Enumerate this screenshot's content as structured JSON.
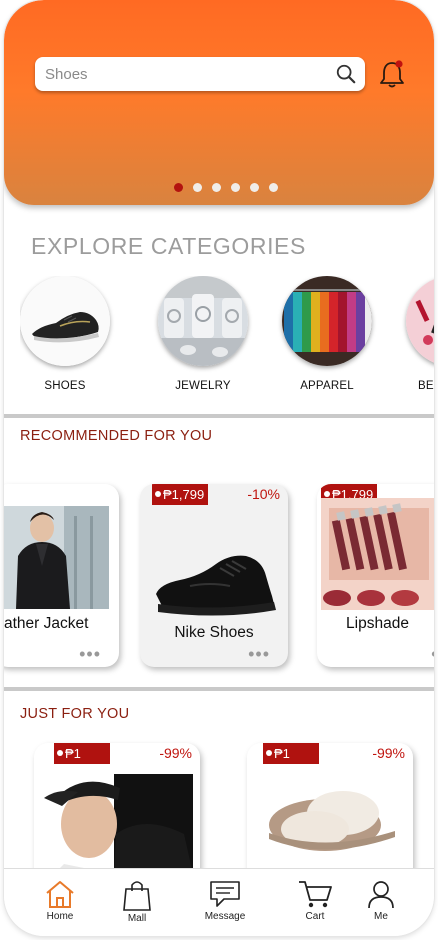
{
  "header": {
    "search_placeholder": "Shoes",
    "carousel_pages": 6,
    "carousel_active": 0
  },
  "colors": {
    "brand_orange": "#ff6a23",
    "accent_red": "#b0120f",
    "section_title": "#8b1f10"
  },
  "explore": {
    "title": "EXPLORE CATEGORIES",
    "items": [
      {
        "label": "SHOES",
        "icon": "sneaker-image"
      },
      {
        "label": "JEWELRY",
        "icon": "jewelry-image"
      },
      {
        "label": "APPAREL",
        "icon": "apparel-image"
      },
      {
        "label": "BEA",
        "icon": "beauty-image"
      }
    ]
  },
  "recommended": {
    "title": "RECOMMENDED FOR YOU",
    "items": [
      {
        "name": "ather Jacket",
        "price": "",
        "discount": ""
      },
      {
        "name": "Nike Shoes",
        "price": "₱1,799",
        "discount": "-10%"
      },
      {
        "name": "Lipshade",
        "price": "₱1,799",
        "discount": ""
      }
    ]
  },
  "just_for_you": {
    "title": "JUST FOR YOU",
    "items": [
      {
        "price": "₱1",
        "discount": "-99%"
      },
      {
        "price": "₱1",
        "discount": "-99%"
      }
    ]
  },
  "bottom_nav": [
    {
      "label": "Home",
      "icon": "home-icon",
      "active": true
    },
    {
      "label": "Mall",
      "icon": "shopping-bag-icon",
      "active": false
    },
    {
      "label": "Message",
      "icon": "message-icon",
      "active": false
    },
    {
      "label": "Cart",
      "icon": "cart-icon",
      "active": false
    },
    {
      "label": "Me",
      "icon": "user-icon",
      "active": false
    }
  ]
}
